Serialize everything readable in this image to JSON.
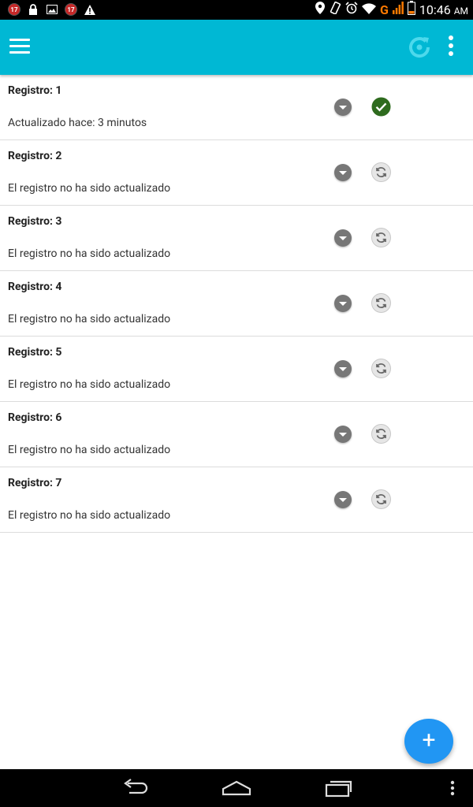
{
  "status_bar": {
    "notification_badge_text": "17",
    "time": "10:46",
    "ampm": "AM",
    "network_letter": "G"
  },
  "toolbar": {
    "menu_icon": "hamburger-icon",
    "refresh_icon": "refresh-icon",
    "overflow_icon": "more-vert-icon"
  },
  "colors": {
    "toolbar": "#00b8d4",
    "fab": "#2196f3",
    "synced": "#2e6b1e",
    "dropdown": "#777777"
  },
  "records": [
    {
      "title": "Registro: 1",
      "subtitle": "Actualizado hace: 3 minutos",
      "status": "synced"
    },
    {
      "title": "Registro: 2",
      "subtitle": "El registro no ha sido actualizado",
      "status": "pending"
    },
    {
      "title": "Registro: 3",
      "subtitle": "El registro no ha sido actualizado",
      "status": "pending"
    },
    {
      "title": "Registro: 4",
      "subtitle": "El registro no ha sido actualizado",
      "status": "pending"
    },
    {
      "title": "Registro: 5",
      "subtitle": "El registro no ha sido actualizado",
      "status": "pending"
    },
    {
      "title": "Registro: 6",
      "subtitle": "El registro no ha sido actualizado",
      "status": "pending"
    },
    {
      "title": "Registro: 7",
      "subtitle": "El registro no ha sido actualizado",
      "status": "pending"
    }
  ],
  "fab": {
    "label": "+"
  }
}
